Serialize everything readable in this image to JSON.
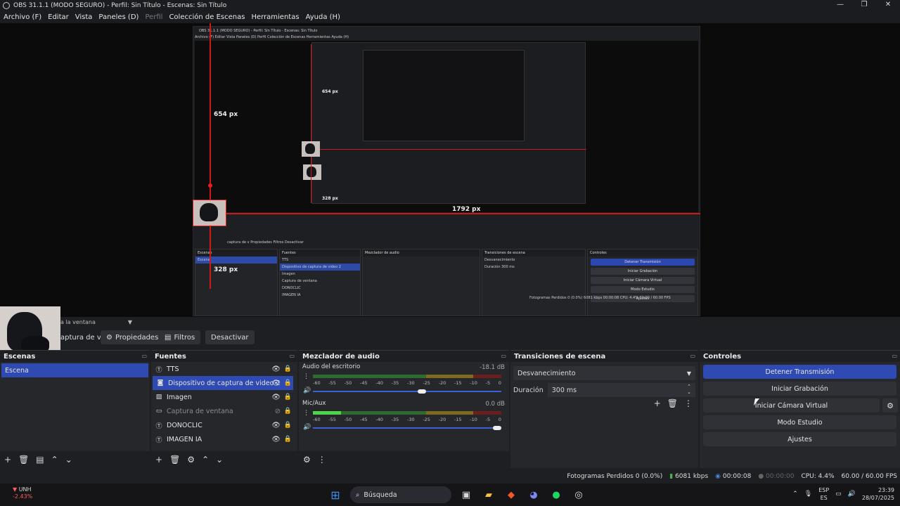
{
  "window": {
    "title": "OBS 31.1.1 (MODO SEGURO) - Perfil: Sin Título - Escenas: Sin Título",
    "controls": [
      "—",
      "❐",
      "✕"
    ]
  },
  "menu": [
    "Archivo (F)",
    "Editar",
    "Vista",
    "Paneles (D)",
    "Perfil",
    "Colección de Escenas",
    "Herramientas",
    "Ayuda (H)"
  ],
  "preview": {
    "measure_654": "654 px",
    "measure_328": "328 px",
    "measure_1792": "1792 px",
    "inner_title": "OBS 31.1.1 (MODO SEGURO) - Perfil: Sin Título - Escenas: Sin Título",
    "inner_menu": "Archivo (F)   Editar   Vista   Paneles (D)   Perfil   Colección de Escenas   Herramientas   Ayuda (H)",
    "inner_tabs": "captura de v   Propiedades   Filtros   Desactivar",
    "inner_scene_header": "Escenas",
    "inner_scene": "Escena",
    "inner_sources_header": "Fuentes",
    "inner_sources": [
      "TTS",
      "Dispositivo de captura de video 2",
      "Imagen",
      "Captura de ventana",
      "DONOCLIC",
      "IMAGEN IA"
    ],
    "inner_mixer_header": "Mezclador de audio",
    "inner_trans_header": "Transiciones de escena",
    "inner_trans_value": "Desvanecimiento",
    "inner_duration": "Duración   300 ms",
    "inner_controls_header": "Controles",
    "inner_controls": [
      "Detener Transmisión",
      "Iniciar Grabación",
      "Iniciar Cámara Virtual",
      "Modo Estudio",
      "Ajustes"
    ],
    "inner_status": "Fotogramas Perdidos 0 (0.0%)   6081 kbps   00:00:08   CPU: 4.4%   60.00 / 60.00 FPS"
  },
  "scene_bar": {
    "label": "a la ventana"
  },
  "source_toolbar": {
    "source_name": "aptura de v",
    "properties": "Propiedades",
    "filters": "Filtros",
    "deactivate": "Desactivar"
  },
  "scenes": {
    "title": "Escenas",
    "items": [
      "Escena"
    ]
  },
  "sources": {
    "title": "Fuentes",
    "items": [
      {
        "label": "TTS",
        "icon": "text-icon"
      },
      {
        "label": "Dispositivo de captura de video 2",
        "icon": "camera-icon"
      },
      {
        "label": "Imagen",
        "icon": "image-icon"
      },
      {
        "label": "Captura de ventana",
        "icon": "window-icon"
      },
      {
        "label": "DONOCLIC",
        "icon": "text-icon"
      },
      {
        "label": "IMAGEN IA",
        "icon": "text-icon"
      }
    ]
  },
  "mixer": {
    "title": "Mezclador de audio",
    "tracks": [
      {
        "name": "Audio del escritorio",
        "db": "-18.1 dB",
        "level": 0.0,
        "volume": 0.6
      },
      {
        "name": "Mic/Aux",
        "db": "0.0 dB",
        "level": 0.15,
        "volume": 1.0
      }
    ],
    "ticks": [
      "-60",
      "-55",
      "-50",
      "-45",
      "-40",
      "-35",
      "-30",
      "-25",
      "-20",
      "-15",
      "-10",
      "-5",
      "0"
    ]
  },
  "transitions": {
    "title": "Transiciones de escena",
    "selected": "Desvanecimiento",
    "duration_label": "Duración",
    "duration_value": "300 ms"
  },
  "controls": {
    "title": "Controles",
    "stop_stream": "Detener Transmisión",
    "start_record": "Iniciar Grabación",
    "virtual_cam": "Iniciar Cámara Virtual",
    "studio_mode": "Modo Estudio",
    "settings": "Ajustes"
  },
  "status": {
    "dropped": "Fotogramas Perdidos 0 (0.0%)",
    "bitrate": "6081 kbps",
    "stream_time": "00:00:08",
    "rec_time": "00:00:00",
    "cpu": "CPU: 4.4%",
    "fps": "60.00 / 60.00 FPS"
  },
  "taskbar": {
    "stock_name": "UNH",
    "stock_change": "-2.43%",
    "search_placeholder": "Búsqueda",
    "lang1": "ESP",
    "lang2": "ES",
    "time": "23:39",
    "date": "28/07/2025"
  },
  "colors": {
    "accent": "#2f4ab2",
    "measure_red": "#d01818",
    "bg": "#1e1f22",
    "panel": "#26272b"
  }
}
